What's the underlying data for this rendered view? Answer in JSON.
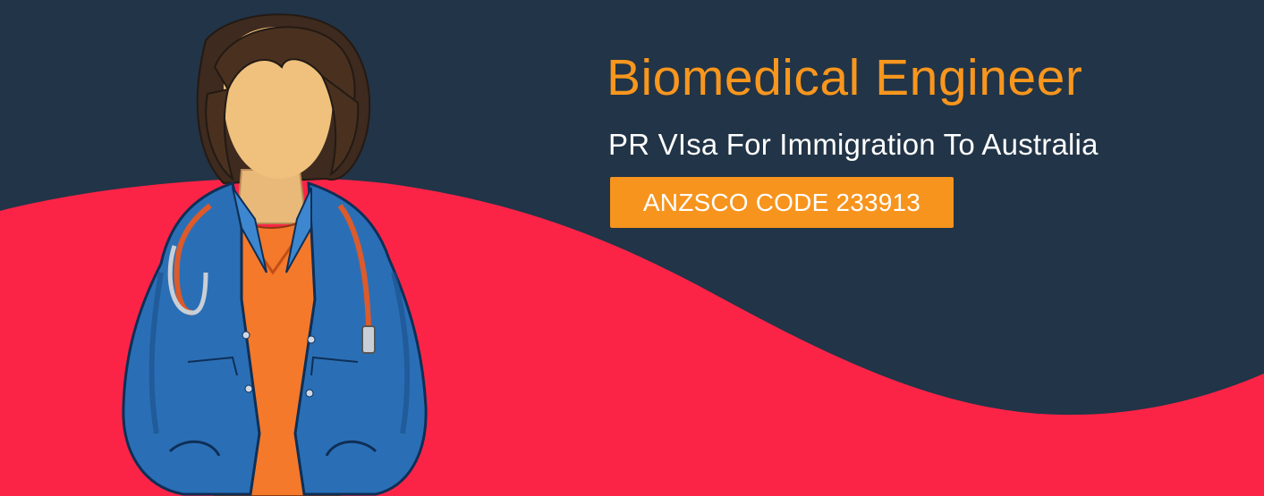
{
  "banner": {
    "title": "Biomedical Engineer",
    "subtitle": "PR VIsa For Immigration To Australia",
    "code_label": "ANZSCO CODE 233913"
  },
  "colors": {
    "background_navy": "#223447",
    "wave_red": "#fb2447",
    "accent_orange": "#f7941d",
    "text_white": "#ffffff"
  },
  "illustration": {
    "icon": "doctor-with-stethoscope-illustration"
  }
}
